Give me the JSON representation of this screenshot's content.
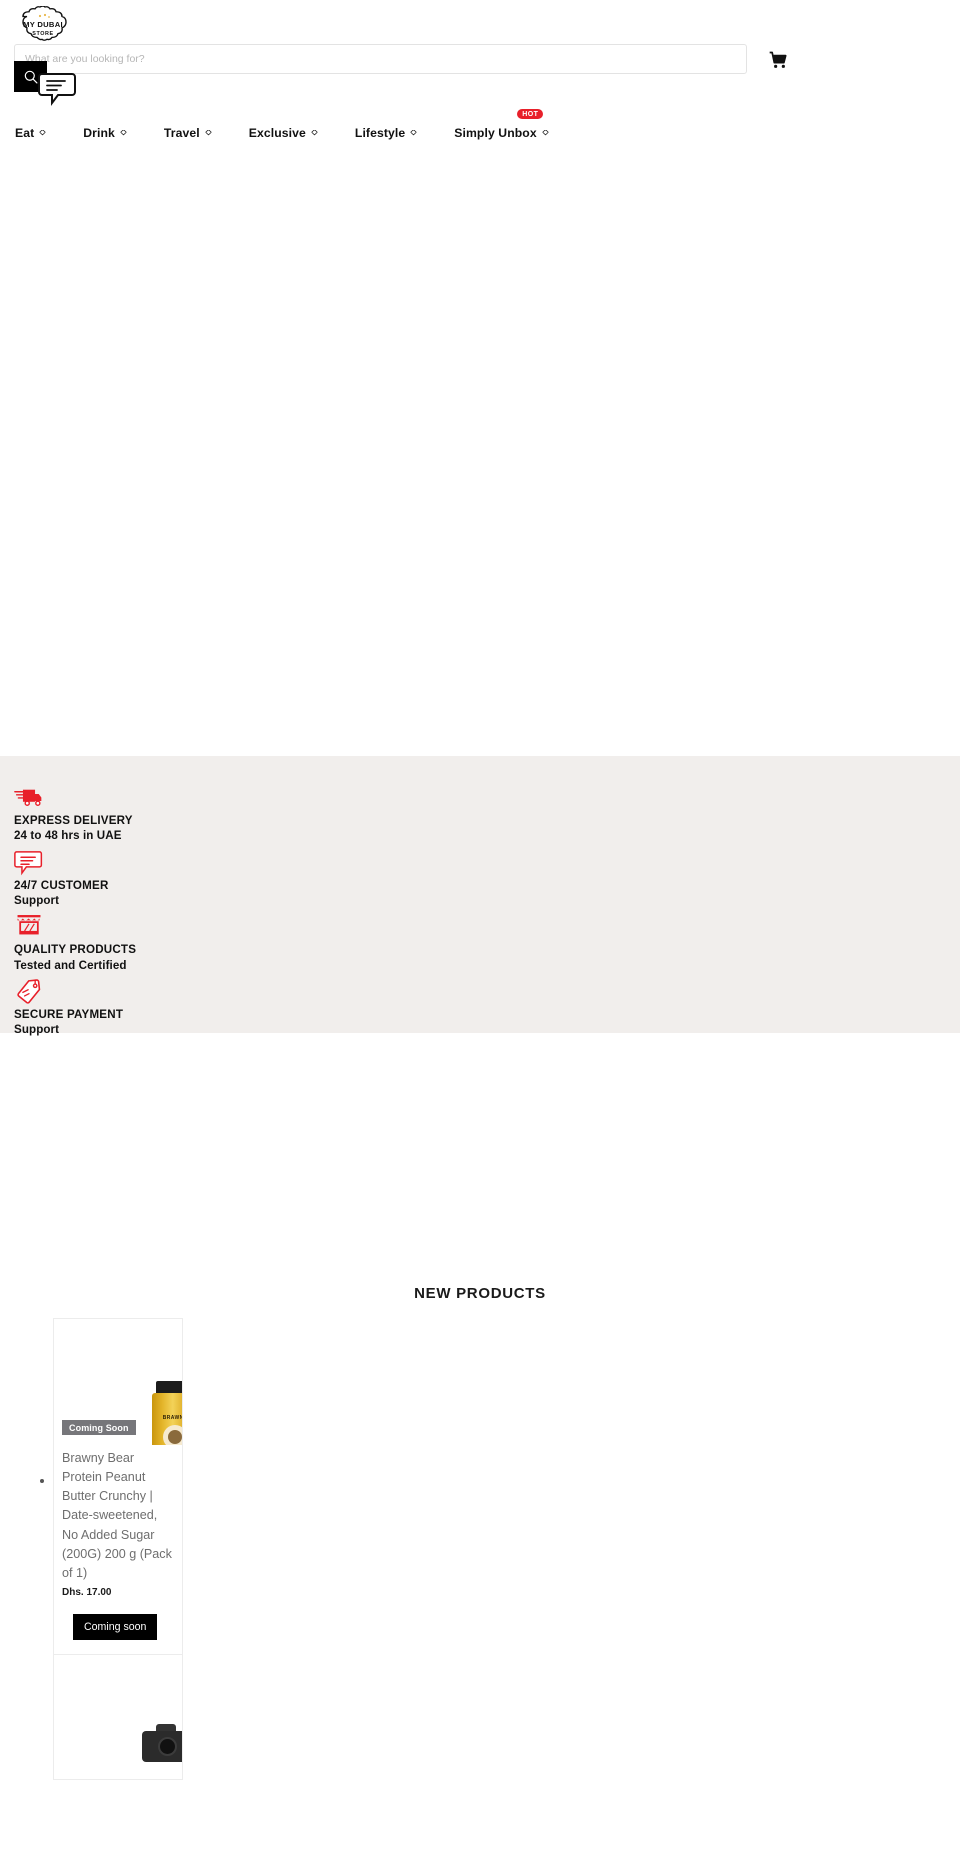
{
  "site": {
    "logo_line1": "MY DUBAI",
    "logo_line2": "STORE"
  },
  "header": {
    "search_placeholder": "What are you looking for?",
    "search_value": "",
    "search_icon": "search-icon",
    "cart_icon": "shopping-cart-icon",
    "chat_icon": "chat-bubble-icon"
  },
  "nav": {
    "items": [
      {
        "label": "Eat",
        "has_chevron": true,
        "badge": ""
      },
      {
        "label": "Drink",
        "has_chevron": true,
        "badge": ""
      },
      {
        "label": "Travel",
        "has_chevron": true,
        "badge": ""
      },
      {
        "label": "Exclusive",
        "has_chevron": true,
        "badge": ""
      },
      {
        "label": "Lifestyle",
        "has_chevron": true,
        "badge": ""
      },
      {
        "label": "Simply Unbox",
        "has_chevron": true,
        "badge": "HOT"
      }
    ]
  },
  "trust": {
    "items": [
      {
        "icon": "delivery-truck-icon",
        "title": "EXPRESS DELIVERY",
        "subtitle": "24 to 48 hrs in UAE"
      },
      {
        "icon": "chat-bubble-icon",
        "title": "24/7 CUSTOMER",
        "subtitle": "Support"
      },
      {
        "icon": "storefront-icon",
        "title": "QUALITY PRODUCTS",
        "subtitle": "Tested and Certified"
      },
      {
        "icon": "price-tag-icon",
        "title": "SECURE PAYMENT",
        "subtitle": "Support"
      }
    ]
  },
  "new_products": {
    "heading": "NEW PRODUCTS",
    "items": [
      {
        "badge": "Coming Soon",
        "title": "Brawny Bear Protein Peanut Butter Crunchy | Date-sweetened, No Added Sugar (200G) 200 g (Pack of 1)",
        "price": "Dhs. 17.00",
        "button": "Coming soon",
        "image_label": "BRAWNY BEAR"
      }
    ]
  },
  "colors": {
    "accent_red": "#e8202a",
    "badge_gray": "#76767a",
    "strip_bg": "#f1eeec",
    "button_black": "#000000"
  }
}
